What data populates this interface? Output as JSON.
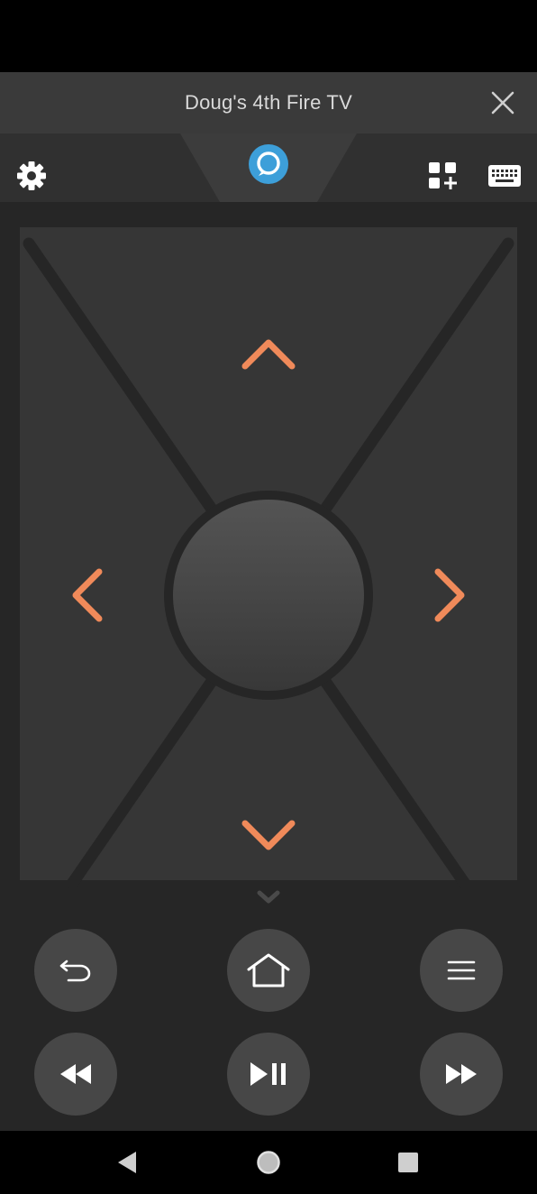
{
  "header": {
    "title": "Doug's 4th Fire TV"
  },
  "icons": {
    "close": "close-icon",
    "settings": "gear-icon",
    "alexa": "alexa-icon",
    "apps": "apps-add-icon",
    "keyboard": "keyboard-icon",
    "dpad_up": "chevron-up-icon",
    "dpad_down": "chevron-down-icon",
    "dpad_left": "chevron-left-icon",
    "dpad_right": "chevron-right-icon",
    "collapse": "chevron-down-icon",
    "back": "back-arrow-icon",
    "home": "home-icon",
    "menu": "menu-icon",
    "rewind": "rewind-icon",
    "play_pause": "play-pause-icon",
    "fast_forward": "fast-forward-icon",
    "nav_back": "triangle-back-icon",
    "nav_home": "circle-home-icon",
    "nav_recents": "square-recents-icon"
  },
  "colors": {
    "accent": "#f08a5a",
    "alexa": "#3d9fd9",
    "background": "#262626",
    "header": "#3a3a3a"
  }
}
